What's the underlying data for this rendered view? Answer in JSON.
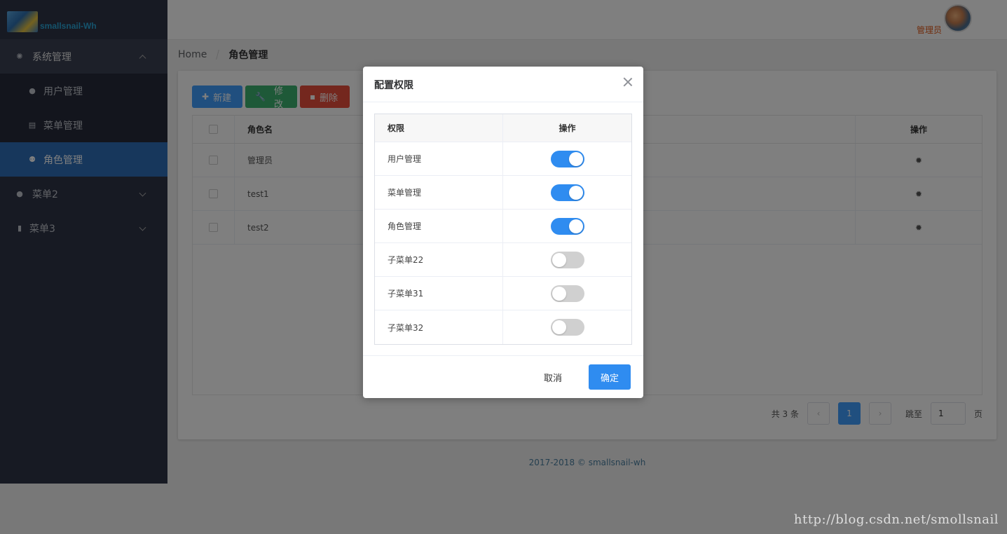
{
  "app": {
    "logo_text": "smallsnail-Wh"
  },
  "header": {
    "user_name": "管理员"
  },
  "sidebar": {
    "items": [
      {
        "label": "系统管理",
        "icon": "gear-icon",
        "expanded": true
      },
      {
        "label": "用户管理",
        "icon": "user-icon"
      },
      {
        "label": "菜单管理",
        "icon": "list-icon"
      },
      {
        "label": "角色管理",
        "icon": "users-icon",
        "active": true
      },
      {
        "label": "菜单2",
        "icon": "globe-icon"
      },
      {
        "label": "菜单3",
        "icon": "lock-icon"
      }
    ]
  },
  "breadcrumb": {
    "home": "Home",
    "current": "角色管理"
  },
  "toolbar": {
    "add_label": "新建",
    "edit_label": "修改",
    "delete_label": "删除"
  },
  "table": {
    "headers": {
      "name": "角色名",
      "op": "操作"
    },
    "rows": [
      {
        "name": "管理员"
      },
      {
        "name": "test1"
      },
      {
        "name": "test2"
      }
    ]
  },
  "pager": {
    "total": "共 3 条",
    "current_page": "1",
    "goto_label": "跳至",
    "goto_value": "1",
    "page_suffix": "页"
  },
  "footer": {
    "text": "2017-2018 © smallsnail-wh"
  },
  "watermark": "http://blog.csdn.net/smollsnail",
  "dialog": {
    "title": "配置权限",
    "headers": {
      "perm": "权限",
      "op": "操作"
    },
    "rows": [
      {
        "label": "用户管理",
        "enabled": true
      },
      {
        "label": "菜单管理",
        "enabled": true
      },
      {
        "label": "角色管理",
        "enabled": true
      },
      {
        "label": "子菜单22",
        "enabled": false
      },
      {
        "label": "子菜单31",
        "enabled": false
      },
      {
        "label": "子菜单32",
        "enabled": false
      }
    ],
    "cancel_label": "取消",
    "ok_label": "确定"
  },
  "colors": {
    "primary": "#409eff",
    "success": "#3cb371",
    "danger": "#e84f3c",
    "sidebar": "#2e3447"
  }
}
